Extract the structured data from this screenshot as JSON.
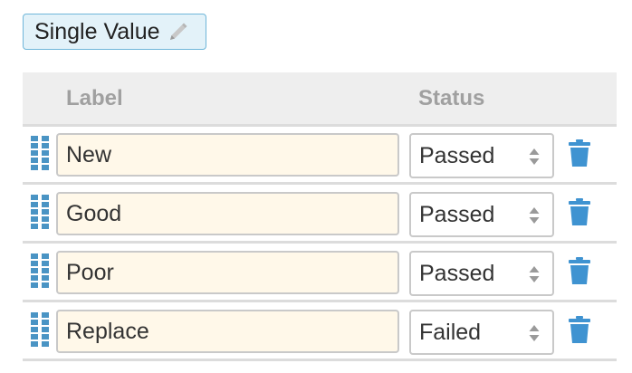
{
  "type_chip": {
    "label": "Single Value",
    "icon": "pencil-icon"
  },
  "table": {
    "headers": {
      "label": "Label",
      "status": "Status"
    },
    "rows": [
      {
        "label": "New",
        "status": "Passed"
      },
      {
        "label": "Good",
        "status": "Passed"
      },
      {
        "label": "Poor",
        "status": "Passed"
      },
      {
        "label": "Replace",
        "status": "Failed"
      }
    ]
  },
  "colors": {
    "accent": "#4a94c4",
    "chip_bg": "#e3f2f9",
    "input_bg": "#fff8e9",
    "header_text": "#a0a0a0"
  }
}
